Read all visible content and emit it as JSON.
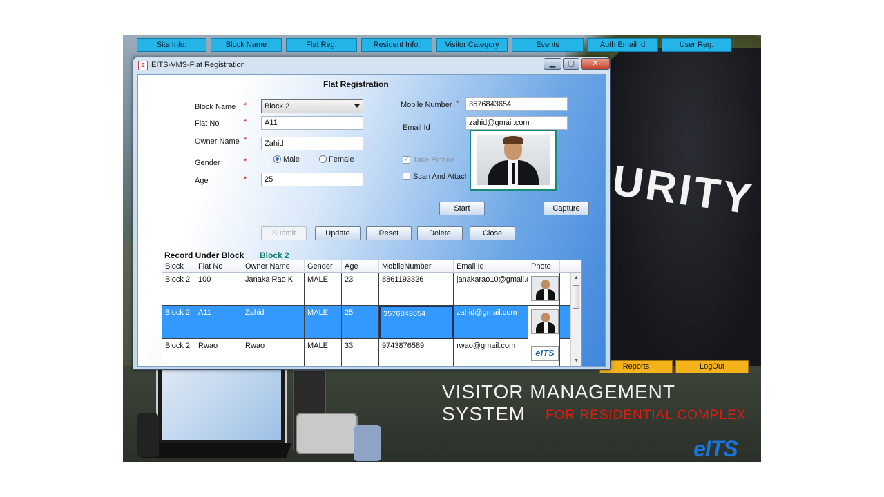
{
  "top_menu": [
    "Site Info.",
    "Block Name",
    "Flat Reg.",
    "Resident Info.",
    "Visitor Category",
    "Events",
    "Auth Email Id",
    "User Reg."
  ],
  "bottom_buttons": {
    "reports": "Reports",
    "logout": "LogOut"
  },
  "branding": {
    "security": "URITY",
    "title": "VISITOR MANAGEMENT SYSTEM",
    "subtitle": "FOR RESIDENTIAL COMPLEX",
    "logo": "eITS"
  },
  "window": {
    "title": "EITS-VMS-Flat Registration",
    "icon": "eits-app-icon",
    "controls": {
      "minimize": "▁",
      "maximize": "▢",
      "close": "✕"
    }
  },
  "form": {
    "heading": "Flat Registration",
    "required_mark": "*",
    "block_label": "Block Name",
    "block_value": "Block 2",
    "flat_label": "Flat No",
    "flat_value": "A11",
    "owner_label": "Owner Name",
    "owner_value": "Zahid",
    "gender_label": "Gender",
    "gender_male": "Male",
    "gender_female": "Female",
    "gender_selected": "Male",
    "age_label": "Age",
    "age_value": "25",
    "mobile_label": "Mobile Number",
    "mobile_value": "3576843654",
    "email_label": "Email Id",
    "email_value": "zahid@gmail.com",
    "take_picture": "Take Picture",
    "scan_attach": "Scan And Attach",
    "check_mark": "✓"
  },
  "buttons": {
    "start": "Start",
    "capture": "Capture",
    "submit": "Submit",
    "update": "Update",
    "reset": "Reset",
    "delete": "Delete",
    "close": "Close"
  },
  "records": {
    "title": "Record Under Block",
    "block": "Block 2",
    "columns": [
      "Block",
      "Flat No",
      "Owner Name",
      "Gender",
      "Age",
      "MobileNumber",
      "Email Id",
      "Photo"
    ],
    "rows": [
      {
        "block": "Block 2",
        "flat": "100",
        "owner": "Janaka Rao K",
        "gender": "MALE",
        "age": "23",
        "mobile": "8861193326",
        "email": "janakarao10@gmail.c",
        "photo": "person"
      },
      {
        "block": "Block 2",
        "flat": "A11",
        "owner": "Zahid",
        "gender": "MALE",
        "age": "25",
        "mobile": "3576843654",
        "email": "zahid@gmail.com",
        "photo": "person"
      },
      {
        "block": "Block 2",
        "flat": "Rwao",
        "owner": "Rwao",
        "gender": "MALE",
        "age": "33",
        "mobile": "9743876589",
        "email": "rwao@gmail.com",
        "photo": "logo"
      }
    ],
    "thumb_logo": "eITS",
    "scroll_up": "▲",
    "scroll_down": "▼"
  },
  "colors": {
    "menu_button": "#24b4e8",
    "bottom_button": "#f4b21b",
    "selected_row": "#3399ff",
    "block_accent": "#0d7a6b",
    "required": "#d11111",
    "subtitle_red": "#e01a10"
  }
}
